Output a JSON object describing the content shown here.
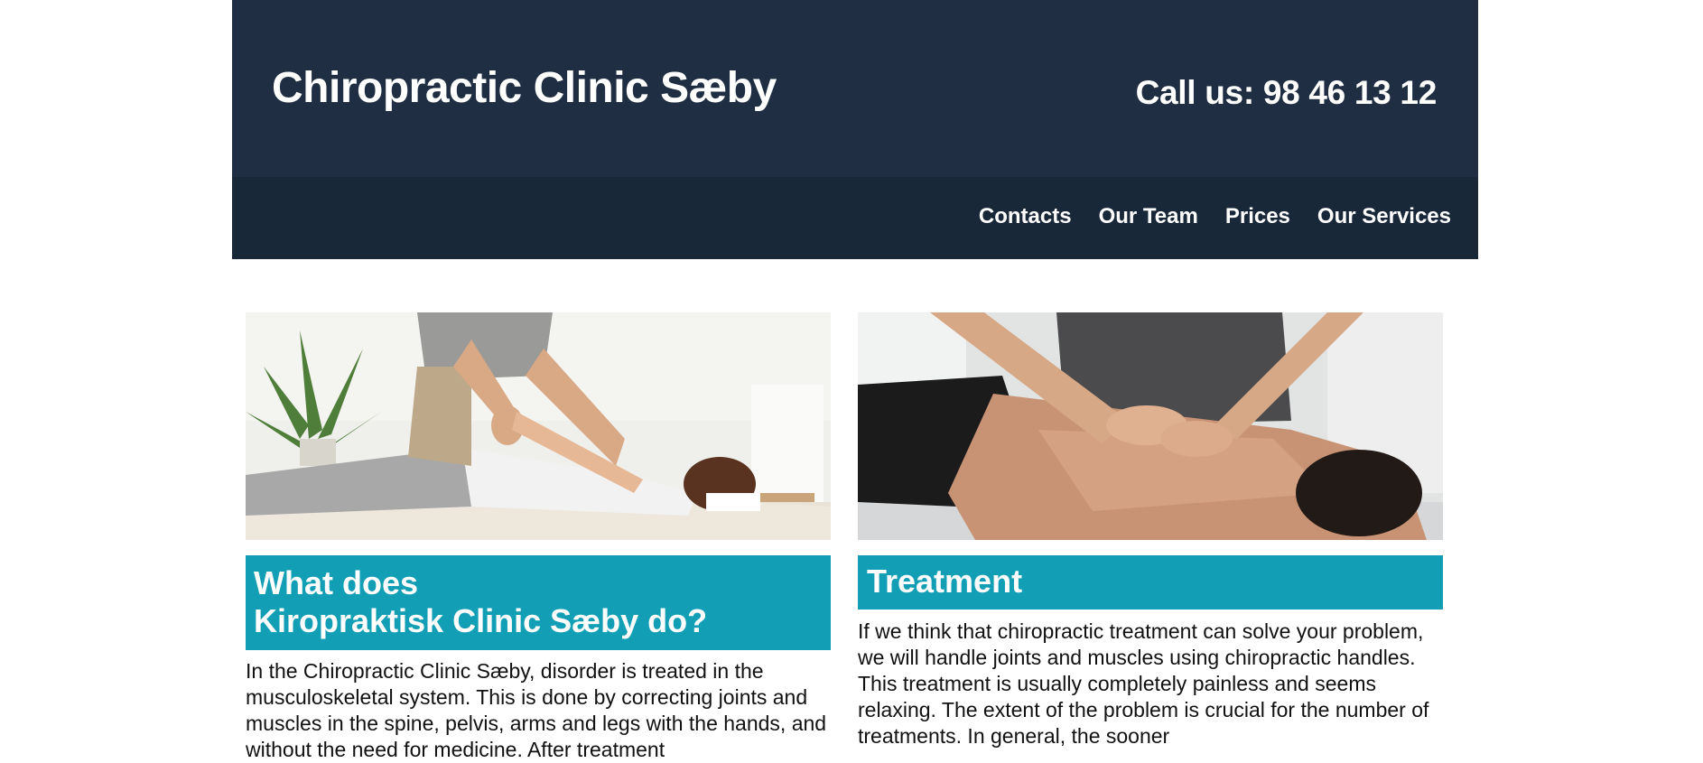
{
  "header": {
    "title": "Chiropractic Clinic Sæby",
    "call": "Call us: 98 46 13 12"
  },
  "nav": {
    "items": [
      "Contacts",
      "Our Team",
      "Prices",
      "Our Services"
    ]
  },
  "cards": [
    {
      "heading_line1": "What does",
      "heading_line2": "Kiropraktisk Clinic Sæby do?",
      "text": "In the Chiropractic Clinic Sæby, disorder is treated in the musculoskeletal system. This is done by correcting joints and muscles in the spine, pelvis, arms and legs with the hands, and without the need for medicine. After treatment"
    },
    {
      "heading": "Treatment",
      "text": "If we think that chiropractic treatment can solve your problem, we will handle joints and muscles using chiropractic handles. This treatment is usually completely painless and seems relaxing. The extent of the problem is crucial for the number of treatments. In general, the sooner"
    }
  ],
  "colors": {
    "header_bg": "#1f2e42",
    "nav_bg": "#192839",
    "heading_bg": "#129fb5"
  }
}
